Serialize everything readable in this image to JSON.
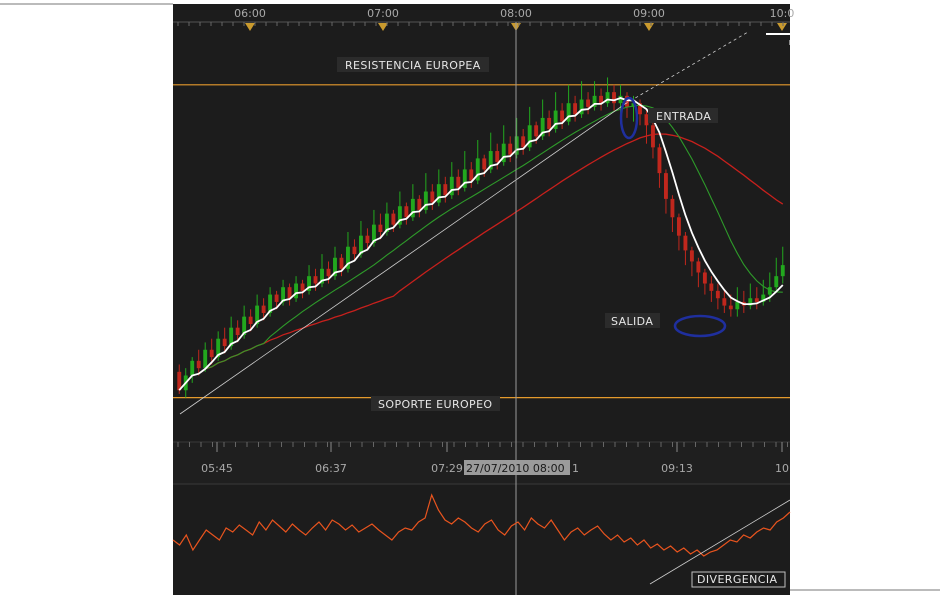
{
  "chart_data": [
    {
      "type": "candlestick",
      "top_time_ticks": [
        "06:00",
        "07:00",
        "08:00",
        "09:00",
        "10:0"
      ],
      "bottom_time_ticks": [
        "05:45",
        "06:37",
        "07:29",
        "09:13",
        "10"
      ],
      "hover_label": "27/07/2010 08:00",
      "hover_suffix": "1",
      "annotations": {
        "resistance": "RESISTENCIA EUROPEA",
        "support": "SOPORTE EUROPEO",
        "entry": "ENTRADA",
        "exit": "SALIDA"
      },
      "y_range": [
        0,
        100
      ],
      "levels": {
        "resistance": 90,
        "support": 5
      },
      "candles": [
        [
          12,
          7,
          14,
          6
        ],
        [
          7,
          11,
          13,
          5
        ],
        [
          11,
          15,
          16,
          9
        ],
        [
          15,
          13,
          18,
          11
        ],
        [
          13,
          18,
          20,
          12
        ],
        [
          18,
          16,
          21,
          14
        ],
        [
          16,
          21,
          23,
          15
        ],
        [
          21,
          19,
          24,
          17
        ],
        [
          19,
          24,
          27,
          18
        ],
        [
          24,
          22,
          26,
          20
        ],
        [
          22,
          27,
          30,
          21
        ],
        [
          27,
          25,
          29,
          23
        ],
        [
          25,
          30,
          33,
          24
        ],
        [
          30,
          28,
          32,
          26
        ],
        [
          28,
          33,
          35,
          27
        ],
        [
          33,
          31,
          34,
          29
        ],
        [
          31,
          35,
          37,
          30
        ],
        [
          35,
          32,
          36,
          30
        ],
        [
          32,
          36,
          38,
          31
        ],
        [
          36,
          34,
          37,
          32
        ],
        [
          34,
          38,
          41,
          33
        ],
        [
          38,
          36,
          40,
          34
        ],
        [
          36,
          40,
          44,
          35
        ],
        [
          40,
          38,
          42,
          36
        ],
        [
          38,
          43,
          46,
          37
        ],
        [
          43,
          40,
          44,
          38
        ],
        [
          40,
          46,
          50,
          39
        ],
        [
          46,
          44,
          48,
          42
        ],
        [
          44,
          49,
          53,
          43
        ],
        [
          49,
          47,
          51,
          45
        ],
        [
          47,
          52,
          56,
          46
        ],
        [
          52,
          50,
          55,
          48
        ],
        [
          50,
          55,
          58,
          49
        ],
        [
          55,
          52,
          56,
          50
        ],
        [
          52,
          57,
          61,
          51
        ],
        [
          57,
          54,
          58,
          52
        ],
        [
          54,
          59,
          63,
          53
        ],
        [
          59,
          56,
          60,
          54
        ],
        [
          56,
          61,
          66,
          55
        ],
        [
          61,
          58,
          63,
          56
        ],
        [
          58,
          63,
          67,
          57
        ],
        [
          63,
          60,
          65,
          58
        ],
        [
          60,
          65,
          69,
          59
        ],
        [
          65,
          62,
          67,
          60
        ],
        [
          62,
          67,
          72,
          61
        ],
        [
          67,
          64,
          69,
          62
        ],
        [
          64,
          70,
          75,
          63
        ],
        [
          70,
          67,
          71,
          65
        ],
        [
          67,
          72,
          77,
          66
        ],
        [
          72,
          69,
          74,
          67
        ],
        [
          69,
          74,
          79,
          68
        ],
        [
          74,
          71,
          76,
          69
        ],
        [
          71,
          76,
          81,
          70
        ],
        [
          76,
          73,
          78,
          71
        ],
        [
          73,
          79,
          84,
          72
        ],
        [
          79,
          76,
          80,
          74
        ],
        [
          76,
          81,
          86,
          75
        ],
        [
          81,
          78,
          83,
          76
        ],
        [
          78,
          83,
          88,
          77
        ],
        [
          83,
          80,
          85,
          78
        ],
        [
          80,
          85,
          90,
          79
        ],
        [
          85,
          82,
          87,
          80
        ],
        [
          82,
          86,
          91,
          81
        ],
        [
          86,
          84,
          88,
          82
        ],
        [
          84,
          87,
          91,
          83
        ],
        [
          87,
          85,
          89,
          83
        ],
        [
          85,
          88,
          92,
          84
        ],
        [
          88,
          85,
          90,
          83
        ],
        [
          85,
          87,
          90,
          82
        ],
        [
          87,
          84,
          88,
          81
        ],
        [
          84,
          85,
          87,
          80
        ],
        [
          85,
          82,
          86,
          79
        ],
        [
          82,
          79,
          83,
          74
        ],
        [
          79,
          73,
          80,
          70
        ],
        [
          73,
          66,
          74,
          62
        ],
        [
          66,
          59,
          67,
          55
        ],
        [
          59,
          54,
          60,
          50
        ],
        [
          54,
          49,
          55,
          45
        ],
        [
          49,
          45,
          50,
          41
        ],
        [
          45,
          42,
          46,
          38
        ],
        [
          42,
          39,
          43,
          35
        ],
        [
          39,
          36,
          40,
          33
        ],
        [
          36,
          34,
          38,
          31
        ],
        [
          34,
          32,
          36,
          29
        ],
        [
          32,
          30,
          34,
          28
        ],
        [
          30,
          29,
          33,
          27
        ],
        [
          29,
          31,
          35,
          27
        ],
        [
          31,
          30,
          34,
          28
        ],
        [
          30,
          32,
          36,
          29
        ],
        [
          32,
          31,
          35,
          29
        ],
        [
          31,
          33,
          37,
          30
        ],
        [
          33,
          35,
          39,
          31
        ],
        [
          35,
          38,
          43,
          34
        ],
        [
          38,
          41,
          46,
          36
        ]
      ],
      "indicator": [
        0.5,
        0.45,
        0.55,
        0.4,
        0.5,
        0.6,
        0.55,
        0.5,
        0.62,
        0.58,
        0.65,
        0.6,
        0.55,
        0.68,
        0.6,
        0.7,
        0.64,
        0.58,
        0.66,
        0.6,
        0.55,
        0.62,
        0.68,
        0.6,
        0.7,
        0.66,
        0.6,
        0.65,
        0.58,
        0.62,
        0.66,
        0.6,
        0.55,
        0.5,
        0.58,
        0.62,
        0.6,
        0.68,
        0.72,
        0.95,
        0.8,
        0.7,
        0.66,
        0.72,
        0.68,
        0.62,
        0.58,
        0.66,
        0.7,
        0.6,
        0.55,
        0.64,
        0.68,
        0.6,
        0.72,
        0.66,
        0.62,
        0.7,
        0.6,
        0.5,
        0.58,
        0.62,
        0.55,
        0.6,
        0.64,
        0.56,
        0.5,
        0.55,
        0.48,
        0.52,
        0.45,
        0.5,
        0.42,
        0.46,
        0.4,
        0.44,
        0.38,
        0.42,
        0.36,
        0.4,
        0.34,
        0.38,
        0.4,
        0.45,
        0.5,
        0.48,
        0.55,
        0.52,
        0.58,
        0.62,
        0.6,
        0.68,
        0.72,
        0.78
      ],
      "colors": {
        "background": "#1c1c1c",
        "up": "#22a81e",
        "down": "#c0271d",
        "level": "#e59a2c",
        "ma_fast": "#ffffff",
        "ma_mid": "#2e9b2a",
        "ma_slow": "#c8201c",
        "indicator": "#e8541e",
        "highlight": "#1f2f9e"
      }
    }
  ],
  "annotations2": {
    "divergence": "DIVERGENCIA"
  }
}
